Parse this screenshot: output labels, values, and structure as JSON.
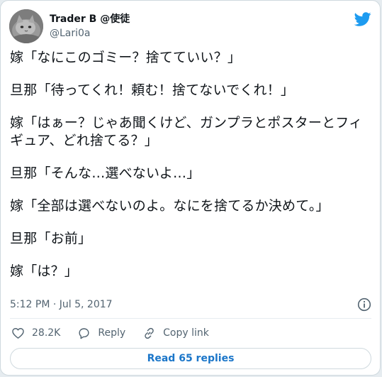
{
  "author": {
    "display_name": "Trader B @使徒",
    "handle": "@Lari0a",
    "avatar_icon": "cat-avatar",
    "logo_icon": "twitter-bird-icon"
  },
  "tweet": {
    "lines": [
      "嫁「なにこのゴミー？捨てていい？」",
      "旦那「待ってくれ！頼む！捨てないでくれ！」",
      "嫁「はぁー？じゃあ聞くけど、ガンプラとポスターとフィギュア、どれ捨てる？」",
      "旦那「そんな…選べないよ…」",
      "嫁「全部は選べないのよ。なにを捨てるか決めて。」",
      "旦那「お前」",
      "嫁「は？」"
    ]
  },
  "meta": {
    "timestamp": "5:12 PM · Jul 5, 2017",
    "info_icon": "info-icon"
  },
  "actions": {
    "like_count": "28.2K",
    "reply_label": "Reply",
    "copy_link_label": "Copy link"
  },
  "footer": {
    "read_replies_label": "Read 65 replies"
  },
  "colors": {
    "twitter_blue": "#1d9bf0",
    "link_blue": "#1b76c9",
    "text_primary": "#0f1419",
    "text_secondary": "#536471",
    "border": "#cfd9de"
  }
}
